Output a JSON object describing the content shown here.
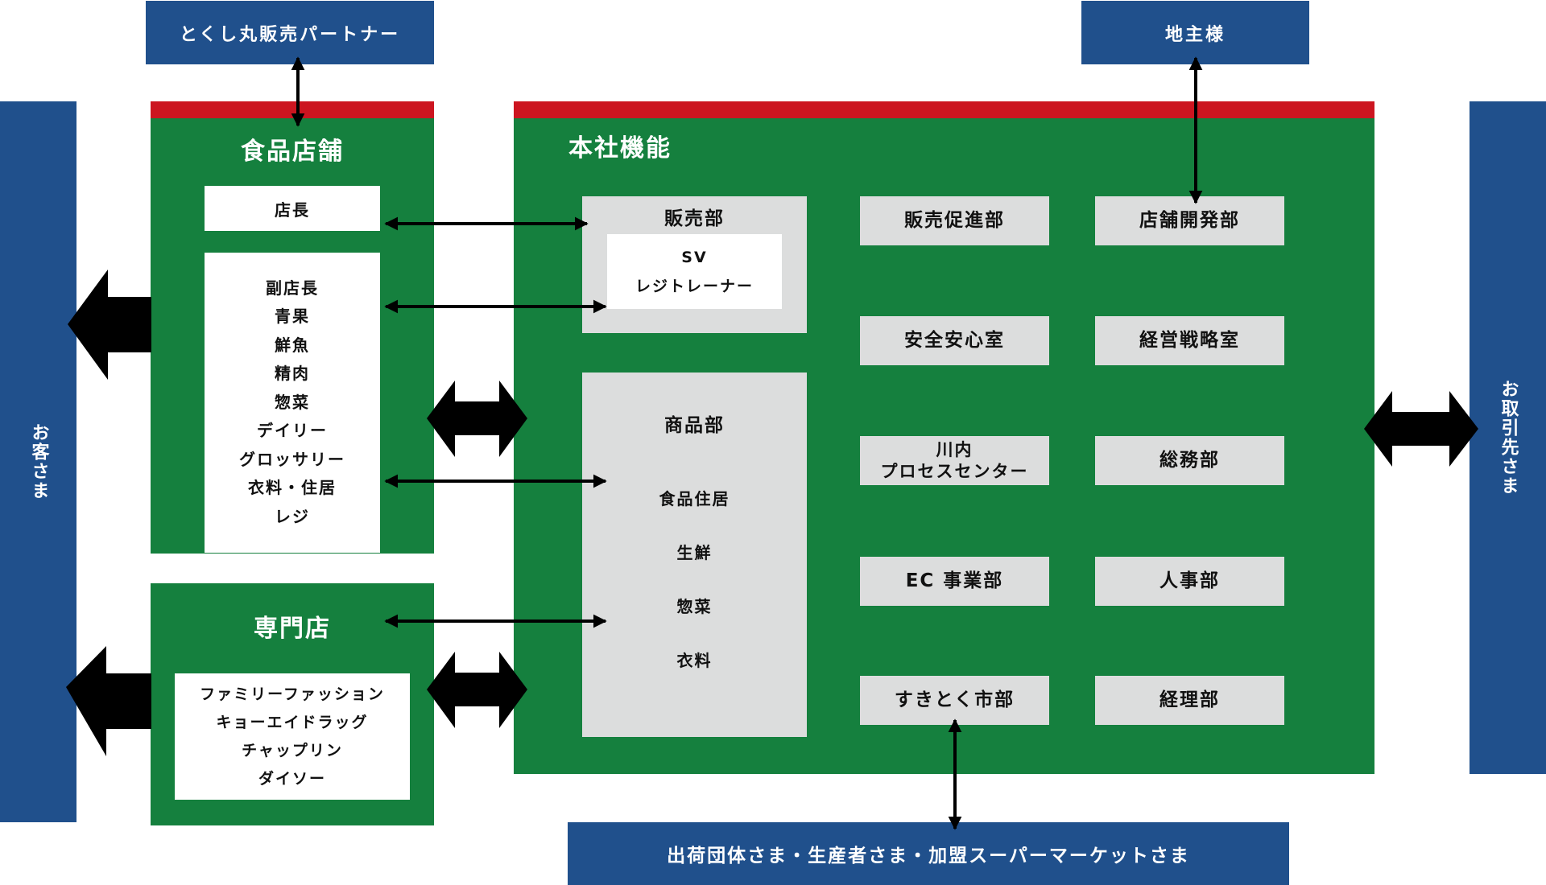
{
  "external": {
    "partner": "とくし丸販売パートナー",
    "landowner": "地主様",
    "customers": "お客さま",
    "business_partners": "お取引先さま",
    "suppliers": "出荷団体さま・生産者さま・加盟スーパーマーケットさま"
  },
  "food_store": {
    "title": "食品店舗",
    "manager": "店長",
    "staff": [
      "副店長",
      "青果",
      "鮮魚",
      "精肉",
      "惣菜",
      "デイリー",
      "グロッサリー",
      "衣料・住居",
      "レジ"
    ]
  },
  "specialty_store": {
    "title": "専門店",
    "stores": [
      "ファミリーファッション",
      "キョーエイドラッグ",
      "チャップリン",
      "ダイソー"
    ]
  },
  "headquarters": {
    "title": "本社機能",
    "sales_dept": {
      "title": "販売部",
      "roles": [
        "SV",
        "レジトレーナー"
      ]
    },
    "merchandise_dept": {
      "title": "商品部",
      "sections": [
        "食品住居",
        "生鮮",
        "惣菜",
        "衣料"
      ]
    },
    "departments_col1": [
      "販売促進部",
      "安全安心室",
      "川内\nプロセスセンター",
      "EC 事業部",
      "すきとく市部"
    ],
    "departments_col2": [
      "店舗開発部",
      "経営戦略室",
      "総務部",
      "人事部",
      "経理部"
    ]
  },
  "colors": {
    "external_blue": "#20508c",
    "organization_green": "#15803e",
    "header_red": "#cc1520",
    "department_gray": "#dcdddd"
  }
}
